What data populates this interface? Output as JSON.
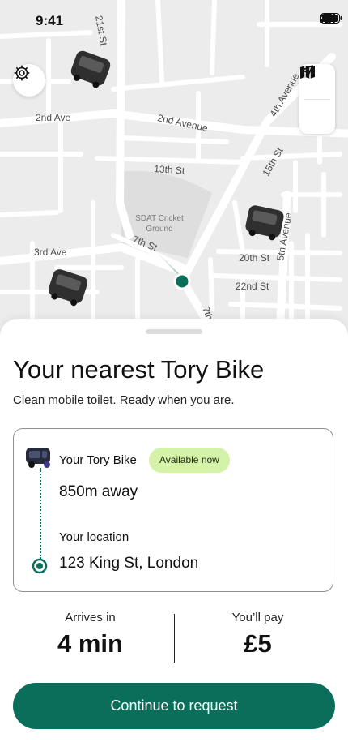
{
  "status": {
    "time": "9:41"
  },
  "map": {
    "streets": [
      "21st St",
      "2nd Ave",
      "2nd Avenue",
      "4th Avenue",
      "15th St",
      "13th St",
      "7th St",
      "3rd Ave",
      "20th St",
      "5th Avenue",
      "22nd St",
      "7th"
    ],
    "park_label_line1": "SDAT Cricket",
    "park_label_line2": "Ground"
  },
  "sheet": {
    "title": "Your nearest Tory Bike",
    "subtitle": "Clean mobile toilet. Ready when you are.",
    "card": {
      "bike_label": "Your Tory Bike",
      "badge": "Available now",
      "distance": "850m away",
      "location_label": "Your location",
      "address": "123 King St, London"
    },
    "arrives_label": "Arrives in",
    "arrives_value": "4 min",
    "pay_label": "You’ll pay",
    "pay_value": "£5",
    "cta": "Continue to request"
  },
  "colors": {
    "accent": "#0b6e5a",
    "badge_bg": "#d5f2a9",
    "map_bg": "#ececec",
    "road": "#ffffff"
  },
  "icons": [
    "cellular-icon",
    "wifi-icon",
    "battery-icon",
    "settings-gear-icon",
    "map-icon",
    "navigation-arrow-icon",
    "tory-bike-icon",
    "location-dot-icon"
  ]
}
